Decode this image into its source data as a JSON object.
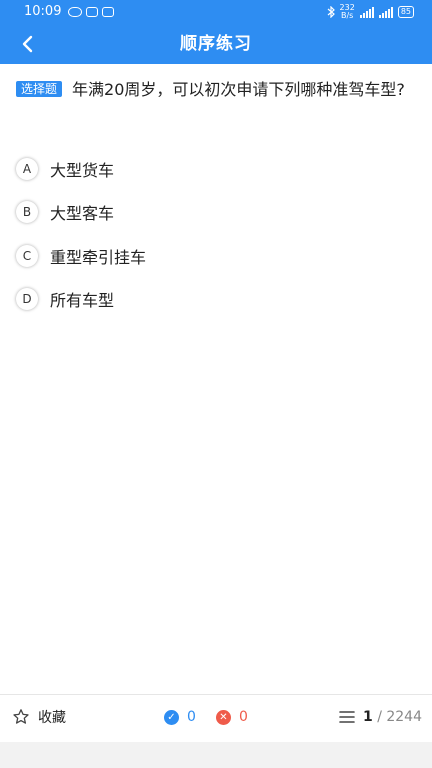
{
  "status_bar": {
    "time": "10:09",
    "network_speed": "232",
    "network_unit": "B/s",
    "battery": "85"
  },
  "header": {
    "title": "顺序练习"
  },
  "question": {
    "type_tag": "选择题",
    "text": "年满20周岁，可以初次申请下列哪种准驾车型?"
  },
  "options": [
    {
      "letter": "A",
      "text": "大型货车"
    },
    {
      "letter": "B",
      "text": "大型客车"
    },
    {
      "letter": "C",
      "text": "重型牵引挂车"
    },
    {
      "letter": "D",
      "text": "所有车型"
    }
  ],
  "bottom_bar": {
    "favorite_label": "收藏",
    "correct_count": "0",
    "wrong_count": "0",
    "current_index": "1",
    "separator": "/",
    "total": "2244"
  },
  "colors": {
    "accent": "#2e8df2",
    "wrong": "#ef5b4a"
  },
  "icons": {
    "back": "back-chevron-icon",
    "favorite": "star-outline-icon",
    "correct": "check-circle-icon",
    "wrong": "cross-circle-icon",
    "list": "list-icon"
  }
}
